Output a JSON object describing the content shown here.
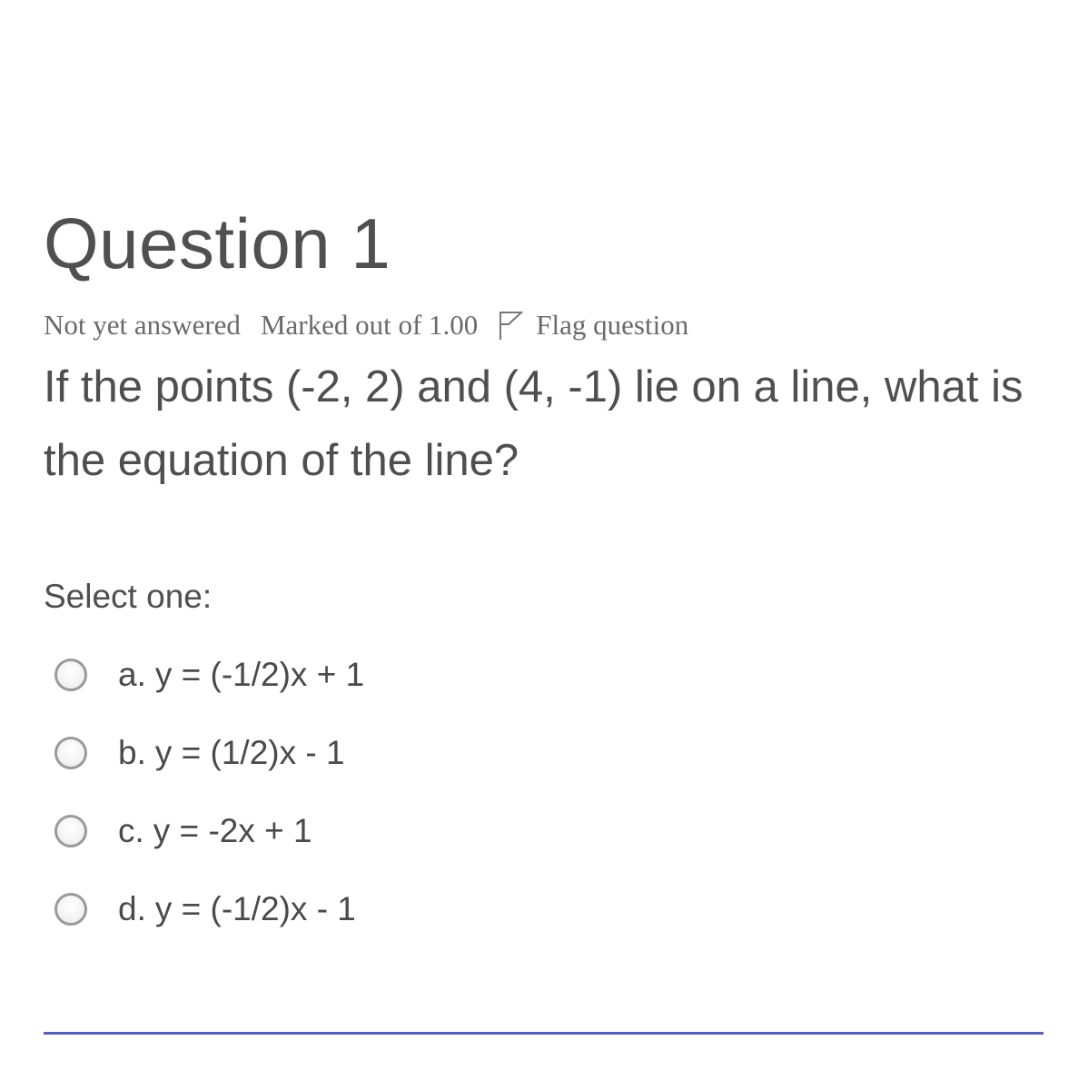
{
  "question": {
    "title": "Question 1",
    "status": "Not yet answered",
    "marks": "Marked out of 1.00",
    "flag_label": "Flag question",
    "flag_icon": "flag-icon",
    "text": "If the points (-2, 2) and (4, -1) lie on a line, what is the equation of the line?"
  },
  "answers": {
    "prompt": "Select one:",
    "options": [
      {
        "letter": "a.",
        "text": "y = (-1/2)x + 1"
      },
      {
        "letter": "b.",
        "text": "y = (1/2)x - 1"
      },
      {
        "letter": "c.",
        "text": "y = -2x + 1"
      },
      {
        "letter": "d.",
        "text": "y = (-1/2)x - 1"
      }
    ]
  },
  "colors": {
    "divider": "#4f5fc8",
    "text": "#4f4f4f"
  }
}
